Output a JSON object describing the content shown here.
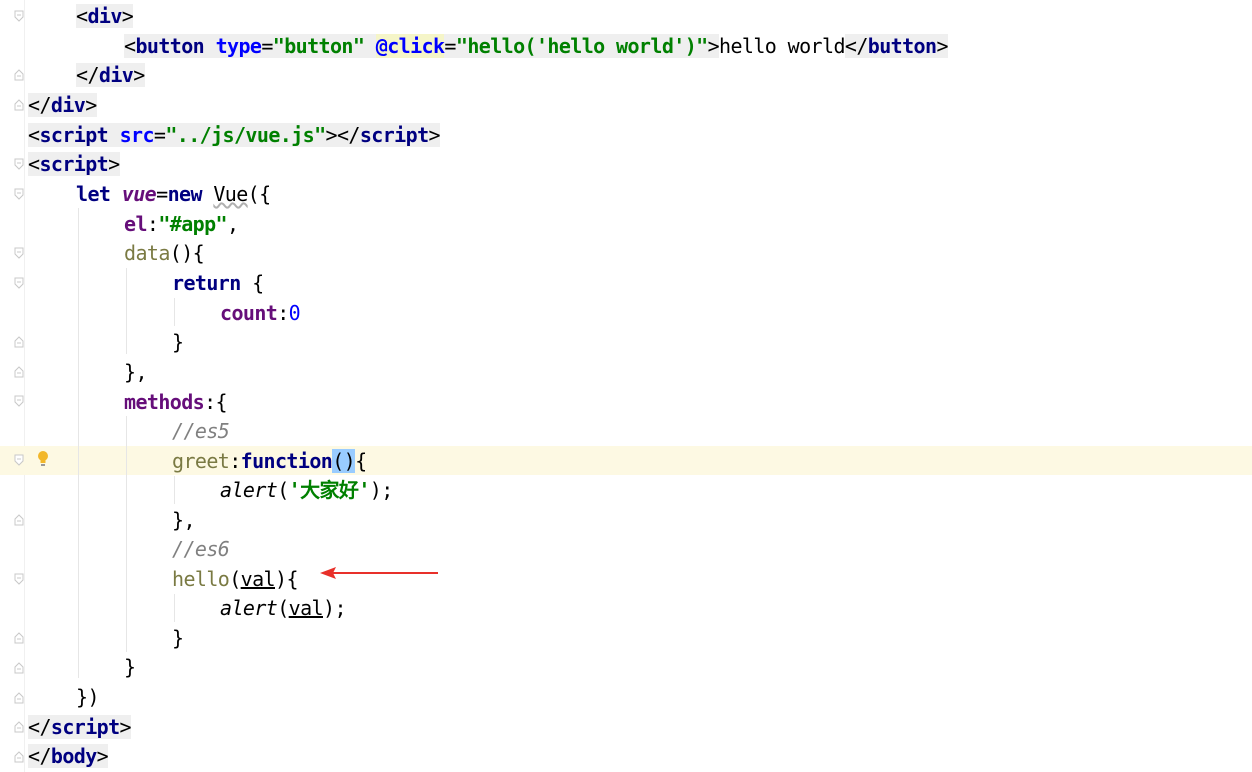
{
  "editor": {
    "lines": [
      [
        "<",
        "div",
        ">"
      ],
      [
        "<",
        "button",
        " ",
        "type",
        "=",
        "\"button\"",
        " ",
        "@click",
        "=",
        "\"hello('hello world')\"",
        ">",
        "hello world",
        "</",
        "button",
        ">"
      ],
      [
        "</",
        "div",
        ">"
      ],
      [
        "</",
        "div",
        ">"
      ],
      [
        "<",
        "script",
        " ",
        "src",
        "=",
        "\"../js/vue.js\"",
        "></",
        "script",
        ">"
      ],
      [
        "<",
        "script",
        ">"
      ],
      [
        "let",
        " ",
        "vue",
        "=",
        "new",
        " ",
        "Vue",
        "({"
      ],
      [
        "el",
        ":",
        "\"#app\"",
        ","
      ],
      [
        "data",
        "(){"
      ],
      [
        "return",
        " {"
      ],
      [
        "count",
        ":",
        "0"
      ],
      [
        "}"
      ],
      [
        "},"
      ],
      [
        "methods",
        ":{"
      ],
      [
        "//es5"
      ],
      [
        "greet",
        ":",
        "function",
        "(",
        ")",
        "{"
      ],
      [
        "alert",
        "(",
        "'大家好'",
        ");"
      ],
      [
        "},"
      ],
      [
        "//es6"
      ],
      [
        "hello",
        "(",
        "val",
        "){"
      ],
      [
        "alert",
        "(",
        "val",
        ");"
      ],
      [
        "}"
      ],
      [
        "}"
      ],
      [
        "})"
      ],
      [
        "</",
        "script",
        ">"
      ],
      [
        "</",
        "body",
        ">"
      ]
    ]
  },
  "colors": {
    "tag": "#000080",
    "attribute": "#0000ff",
    "string": "#008000",
    "keyword": "#000080",
    "property": "#660e7a",
    "function": "#7a7a43",
    "number": "#0000ff",
    "comment": "#808080",
    "current_line": "#fdf9e3",
    "brace_match": "#99ccff",
    "arrow": "#e8302a",
    "bulb": "#f2b72a"
  },
  "icons": {
    "fold_open": "fold-open-icon",
    "fold_close": "fold-close-icon",
    "bulb": "lightbulb-icon",
    "annotation": "red-arrow-annotation"
  }
}
